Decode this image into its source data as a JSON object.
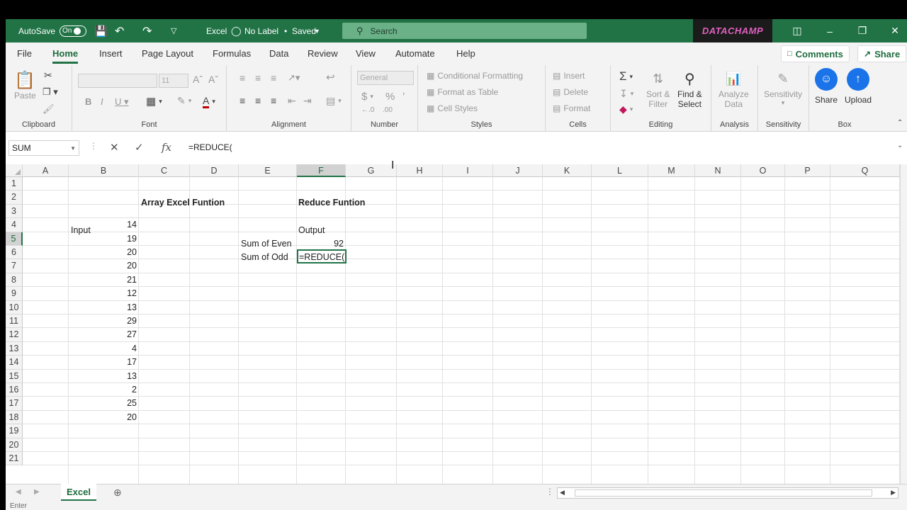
{
  "titlebar": {
    "autosave_label": "AutoSave",
    "autosave_state": "On",
    "app_name": "Excel",
    "label_status": "No Label",
    "save_status": "Saved",
    "search_placeholder": "Search",
    "brand": "DATACHAMP"
  },
  "menu": {
    "tabs": [
      "File",
      "Home",
      "Insert",
      "Page Layout",
      "Formulas",
      "Data",
      "Review",
      "View",
      "Automate",
      "Help"
    ],
    "active_tab": "Home",
    "comments_label": "Comments",
    "share_label": "Share"
  },
  "ribbon": {
    "clipboard": {
      "label": "Clipboard",
      "paste": "Paste"
    },
    "font": {
      "label": "Font",
      "size": "11"
    },
    "alignment": {
      "label": "Alignment"
    },
    "number": {
      "label": "Number",
      "format": "General"
    },
    "styles": {
      "label": "Styles",
      "conditional": "Conditional Formatting",
      "format_table": "Format as Table",
      "cell_styles": "Cell Styles"
    },
    "cells": {
      "label": "Cells",
      "insert": "Insert",
      "delete": "Delete",
      "format": "Format"
    },
    "editing": {
      "label": "Editing",
      "sort_filter_1": "Sort &",
      "sort_filter_2": "Filter",
      "find_select_1": "Find &",
      "find_select_2": "Select"
    },
    "analysis": {
      "label": "Analysis",
      "analyze_1": "Analyze",
      "analyze_2": "Data"
    },
    "sensitivity": {
      "label": "Sensitivity",
      "button": "Sensitivity"
    },
    "box": {
      "label": "Box",
      "share": "Share",
      "upload": "Upload"
    }
  },
  "formula_bar": {
    "name_box": "SUM",
    "formula": "=REDUCE("
  },
  "sheet": {
    "columns": [
      "A",
      "B",
      "C",
      "D",
      "E",
      "F",
      "G",
      "H",
      "I",
      "J",
      "K",
      "L",
      "M",
      "N",
      "O",
      "P",
      "Q"
    ],
    "rows": [
      "1",
      "2",
      "3",
      "4",
      "5",
      "6",
      "7",
      "8",
      "9",
      "10",
      "11",
      "12",
      "13",
      "14",
      "15",
      "16",
      "17",
      "18",
      "19",
      "20",
      "21"
    ],
    "title_left": "Array Excel Funtion",
    "title_right": "Reduce Funtion",
    "input_header": "Input",
    "output_header": "Output",
    "inputs": [
      14,
      19,
      20,
      20,
      21,
      12,
      13,
      29,
      27,
      4,
      17,
      13,
      2,
      25,
      20
    ],
    "labels": [
      "Sum of Even",
      "Sum of Odd"
    ],
    "even_result": "92",
    "odd_editing": "=REDUCE("
  },
  "tabs": {
    "sheet_name": "Excel"
  },
  "status": {
    "mode": "Enter"
  }
}
